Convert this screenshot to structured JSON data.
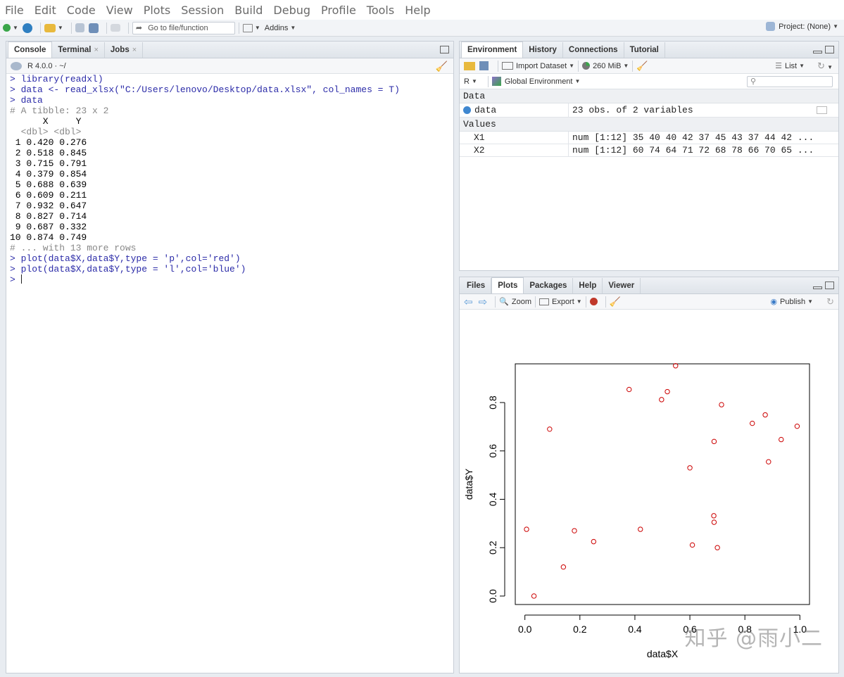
{
  "menu": [
    "File",
    "Edit",
    "Code",
    "View",
    "Plots",
    "Session",
    "Build",
    "Debug",
    "Profile",
    "Tools",
    "Help"
  ],
  "toolbar": {
    "goto_label": "Go to file/function",
    "addins_label": "Addins",
    "project_label": "Project: (None)"
  },
  "console_pane": {
    "tabs": [
      "Console",
      "Terminal",
      "Jobs"
    ],
    "r_version": "R 4.0.0 · ~/",
    "lines": [
      {
        "t": "cmd",
        "s": "> library(readxl)"
      },
      {
        "t": "cmd",
        "s": "> data <- read_xlsx(\"C:/Users/lenovo/Desktop/data.xlsx\", col_names = T)"
      },
      {
        "t": "cmd",
        "s": "> data"
      },
      {
        "t": "cm",
        "s": "# A tibble: 23 x 2"
      },
      {
        "t": "out",
        "s": "      X     Y"
      },
      {
        "t": "cm",
        "s": "  <dbl> <dbl>"
      },
      {
        "t": "out",
        "s": " 1 0.420 0.276"
      },
      {
        "t": "out",
        "s": " 2 0.518 0.845"
      },
      {
        "t": "out",
        "s": " 3 0.715 0.791"
      },
      {
        "t": "out",
        "s": " 4 0.379 0.854"
      },
      {
        "t": "out",
        "s": " 5 0.688 0.639"
      },
      {
        "t": "out",
        "s": " 6 0.609 0.211"
      },
      {
        "t": "out",
        "s": " 7 0.932 0.647"
      },
      {
        "t": "out",
        "s": " 8 0.827 0.714"
      },
      {
        "t": "out",
        "s": " 9 0.687 0.332"
      },
      {
        "t": "out",
        "s": "10 0.874 0.749"
      },
      {
        "t": "cm",
        "s": "# ... with 13 more rows"
      },
      {
        "t": "cmd",
        "s": "> plot(data$X,data$Y,type = 'p',col='red')"
      },
      {
        "t": "cmd",
        "s": "> plot(data$X,data$Y,type = 'l',col='blue')"
      },
      {
        "t": "cmd",
        "s": "> "
      }
    ]
  },
  "env_pane": {
    "tabs": [
      "Environment",
      "History",
      "Connections",
      "Tutorial"
    ],
    "import_label": "Import Dataset",
    "memory_label": "260 MiB",
    "list_label": "List",
    "r_label": "R",
    "global_env_label": "Global Environment",
    "data_header": "Data",
    "values_header": "Values",
    "data_rows": [
      {
        "name": "data",
        "value": "23 obs. of 2 variables"
      }
    ],
    "value_rows": [
      {
        "name": "X1",
        "value": "num [1:12] 35 40 40 42 37 45 43 37 44 42 ..."
      },
      {
        "name": "X2",
        "value": "num [1:12] 60 74 64 71 72 68 78 66 70 65 ..."
      }
    ]
  },
  "plots_pane": {
    "tabs": [
      "Files",
      "Plots",
      "Packages",
      "Help",
      "Viewer"
    ],
    "zoom_label": "Zoom",
    "export_label": "Export",
    "publish_label": "Publish"
  },
  "chart_data": {
    "type": "scatter",
    "xlabel": "data$X",
    "ylabel": "data$Y",
    "xlim": [
      -0.035,
      1.035
    ],
    "ylim": [
      -0.035,
      0.96
    ],
    "xticks": [
      0.0,
      0.2,
      0.4,
      0.6,
      0.8,
      1.0
    ],
    "xtick_labels": [
      "0.0",
      "0.2",
      "0.4",
      "0.6",
      "0.8",
      "1.0"
    ],
    "yticks": [
      0.0,
      0.2,
      0.4,
      0.6,
      0.8
    ],
    "ytick_labels": [
      "0.0",
      "0.2",
      "0.4",
      "0.6",
      "0.8"
    ],
    "point_color": "#cc0000",
    "x": [
      0.006,
      0.033,
      0.09,
      0.14,
      0.18,
      0.25,
      0.379,
      0.42,
      0.497,
      0.518,
      0.548,
      0.6,
      0.609,
      0.687,
      0.688,
      0.688,
      0.7,
      0.715,
      0.827,
      0.874,
      0.886,
      0.932,
      0.99
    ],
    "y": [
      0.276,
      0.0,
      0.69,
      0.12,
      0.27,
      0.225,
      0.854,
      0.276,
      0.812,
      0.845,
      0.952,
      0.53,
      0.211,
      0.332,
      0.305,
      0.639,
      0.2,
      0.791,
      0.714,
      0.749,
      0.555,
      0.647,
      0.702
    ]
  },
  "watermark": "知乎 @雨小二"
}
